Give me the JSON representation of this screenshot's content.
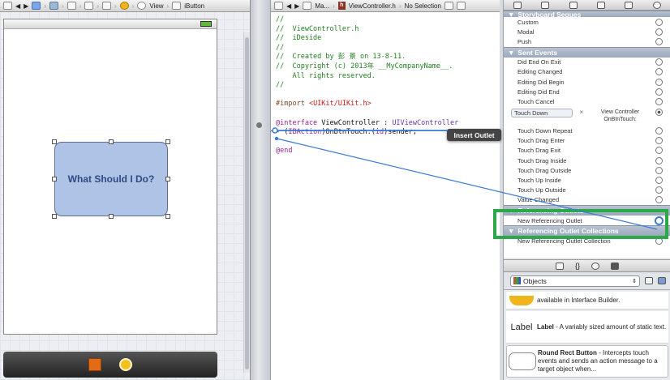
{
  "ib_jumpbar": {
    "items": [
      "View",
      "iButton"
    ]
  },
  "canvas": {
    "button_title": "What Should I Do?"
  },
  "editor_jumpbar": {
    "items": [
      "Ma...",
      "ViewController.h",
      "No Selection"
    ]
  },
  "code_lines": [
    {
      "t": "//",
      "c": "comment"
    },
    {
      "t": "//  ViewController.h",
      "c": "comment"
    },
    {
      "t": "//  iDeside",
      "c": "comment"
    },
    {
      "t": "//",
      "c": "comment"
    },
    {
      "t": "//  Created by 彭 景 on 13-8-11.",
      "c": "comment"
    },
    {
      "t": "//  Copyright (c) 2013年 __MyCompanyName__.",
      "c": "comment"
    },
    {
      "t": "    All rights reserved.",
      "c": "comment"
    },
    {
      "t": "//",
      "c": "comment"
    },
    {
      "t": "",
      "c": "text"
    },
    {
      "t": "#import ",
      "c": "import",
      "extra": "<UIKit/UIKit.h>"
    },
    {
      "t": "",
      "c": "text"
    },
    {
      "t": "@interface ViewController : UIViewController",
      "c": "interface"
    },
    {
      "t": "- (IBAction)OnBtnTouch:(id)sender;",
      "c": "action"
    },
    {
      "t": "",
      "c": "text"
    },
    {
      "t": "@end",
      "c": "keyword"
    }
  ],
  "insert_outlet_label": "Insert Outlet",
  "connections": {
    "storyboard_segues": {
      "title": "Storyboard Segues",
      "rows": [
        "Custom",
        "Modal",
        "Push"
      ]
    },
    "sent_events": {
      "title": "Sent Events",
      "rows": [
        "Did End On Exit",
        "Editing Changed",
        "Editing Did Begin",
        "Editing Did End",
        "Touch Cancel"
      ],
      "connected_event": "Touch Down",
      "connected_target_line1": "View Controller",
      "connected_target_line2": "OnBtnTouch:",
      "rows_after": [
        "Touch Down Repeat",
        "Touch Drag Enter",
        "Touch Drag Exit",
        "Touch Drag Inside",
        "Touch Drag Outside",
        "Touch Up Inside",
        "Touch Up Outside",
        "Value Changed"
      ]
    },
    "referencing_outlets": {
      "title": "Referencing Outlets",
      "rows": [
        "New Referencing Outlet"
      ]
    },
    "outlet_collections": {
      "title": "Referencing Outlet Collections",
      "rows": [
        "New Referencing Outlet Collection"
      ]
    }
  },
  "library": {
    "filter": "Objects",
    "items": [
      {
        "title": "",
        "desc": "available in Interface Builder."
      },
      {
        "title": "Label",
        "desc": " - A variably sized amount of static text.",
        "icon_text": "Label"
      },
      {
        "title": "Round Rect Button",
        "desc": " - Intercepts touch events and sends an action message to a target object when..."
      }
    ]
  },
  "colors": {
    "highlight_green": "#2aa84a",
    "connection_blue": "#3a7bd5",
    "button_fill": "#aec3e6"
  }
}
